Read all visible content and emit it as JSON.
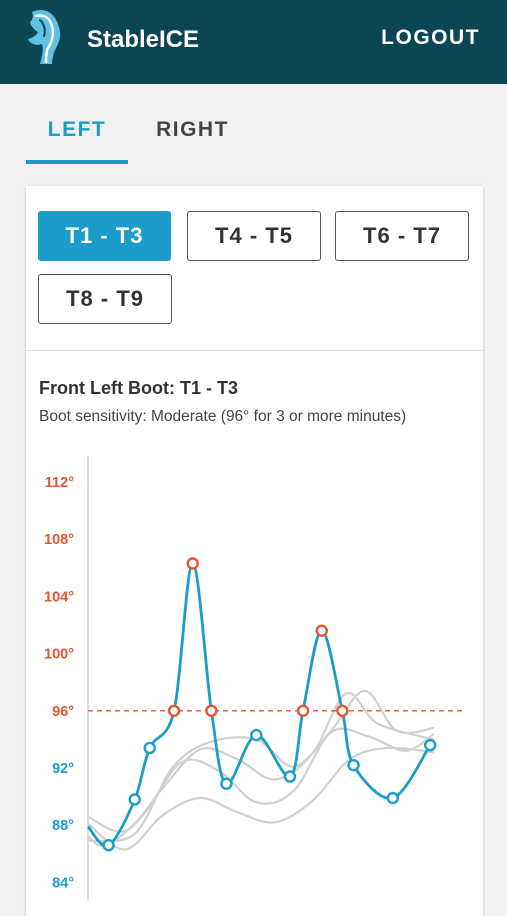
{
  "header": {
    "app_name": "StableICE",
    "logout_label": "LOGOUT",
    "logo_icon": "horse-head-icon"
  },
  "side_tabs": [
    {
      "label": "LEFT",
      "active": true
    },
    {
      "label": "RIGHT",
      "active": false
    }
  ],
  "segment_tabs": [
    {
      "label": "T1 - T3",
      "active": true
    },
    {
      "label": "T4 - T5",
      "active": false
    },
    {
      "label": "T6 - T7",
      "active": false
    },
    {
      "label": "T8 - T9",
      "active": false
    }
  ],
  "chart_panel": {
    "title": "Front Left Boot: T1 - T3",
    "subtitle": "Boot sensitivity: Moderate (96° for 3 or more minutes)"
  },
  "colors": {
    "header_bg": "#0c4554",
    "accent": "#1b9dcb",
    "alert": "#e8542c",
    "ghost_series": "#d0d0d0"
  },
  "chart_data": {
    "type": "line",
    "y_ticks": [
      {
        "value": 112,
        "label": "112°",
        "alert": true
      },
      {
        "value": 108,
        "label": "108°",
        "alert": true
      },
      {
        "value": 104,
        "label": "104°",
        "alert": true
      },
      {
        "value": 100,
        "label": "100°",
        "alert": true
      },
      {
        "value": 96,
        "label": "96°",
        "alert": true
      },
      {
        "value": 92,
        "label": "92°",
        "alert": false
      },
      {
        "value": 88,
        "label": "88°",
        "alert": false
      },
      {
        "value": 84,
        "label": "84°",
        "alert": false
      }
    ],
    "threshold": 96,
    "grid": false,
    "x_range": [
      0,
      20
    ],
    "ylim": [
      82,
      115
    ],
    "series": [
      {
        "role": "main",
        "points": [
          {
            "x": 0,
            "y": 87.9,
            "marker": false
          },
          {
            "x": 1.1,
            "y": 86.6,
            "marker": true
          },
          {
            "x": 2.5,
            "y": 89.8,
            "marker": true
          },
          {
            "x": 3.3,
            "y": 93.4,
            "marker": true
          },
          {
            "x": 4.6,
            "y": 96.0,
            "marker": true
          },
          {
            "x": 5.6,
            "y": 106.3,
            "marker": true
          },
          {
            "x": 6.6,
            "y": 96.0,
            "marker": true
          },
          {
            "x": 7.4,
            "y": 90.9,
            "marker": true
          },
          {
            "x": 9.0,
            "y": 94.3,
            "marker": true
          },
          {
            "x": 10.8,
            "y": 91.4,
            "marker": true
          },
          {
            "x": 11.5,
            "y": 96.0,
            "marker": true
          },
          {
            "x": 12.5,
            "y": 101.6,
            "marker": true
          },
          {
            "x": 13.6,
            "y": 96.0,
            "marker": true
          },
          {
            "x": 14.2,
            "y": 92.2,
            "marker": true
          },
          {
            "x": 16.3,
            "y": 89.9,
            "marker": true
          },
          {
            "x": 18.3,
            "y": 93.6,
            "marker": true
          }
        ]
      },
      {
        "role": "ghost",
        "points": [
          [
            0,
            87.2
          ],
          [
            1,
            86.6
          ],
          [
            3,
            88.8
          ],
          [
            5,
            92.4
          ],
          [
            7,
            91.8
          ],
          [
            9,
            89.6
          ],
          [
            11,
            90.4
          ],
          [
            13,
            94.5
          ],
          [
            15,
            94.2
          ],
          [
            17,
            93.2
          ],
          [
            18.5,
            94.4
          ]
        ]
      },
      {
        "role": "ghost",
        "points": [
          [
            0,
            88.6
          ],
          [
            2,
            87.6
          ],
          [
            4,
            90.6
          ],
          [
            6,
            93.3
          ],
          [
            8,
            92.6
          ],
          [
            10,
            91.2
          ],
          [
            12,
            93.0
          ],
          [
            13.8,
            97.2
          ],
          [
            15.5,
            95.1
          ],
          [
            18.5,
            94.0
          ]
        ]
      },
      {
        "role": "ghost",
        "points": [
          [
            0,
            86.9
          ],
          [
            2.5,
            87.4
          ],
          [
            4.5,
            92.0
          ],
          [
            6.5,
            93.8
          ],
          [
            9,
            94.0
          ],
          [
            11,
            92.1
          ],
          [
            13,
            94.6
          ],
          [
            14.8,
            97.4
          ],
          [
            16.5,
            94.6
          ],
          [
            18.5,
            94.8
          ]
        ]
      },
      {
        "role": "ghost",
        "points": [
          [
            0,
            88.1
          ],
          [
            2,
            86.3
          ],
          [
            4,
            88.7
          ],
          [
            6,
            89.9
          ],
          [
            8,
            88.9
          ],
          [
            10,
            88.2
          ],
          [
            12,
            89.7
          ],
          [
            14,
            92.6
          ],
          [
            16,
            93.4
          ],
          [
            18.5,
            93.1
          ]
        ]
      }
    ]
  }
}
